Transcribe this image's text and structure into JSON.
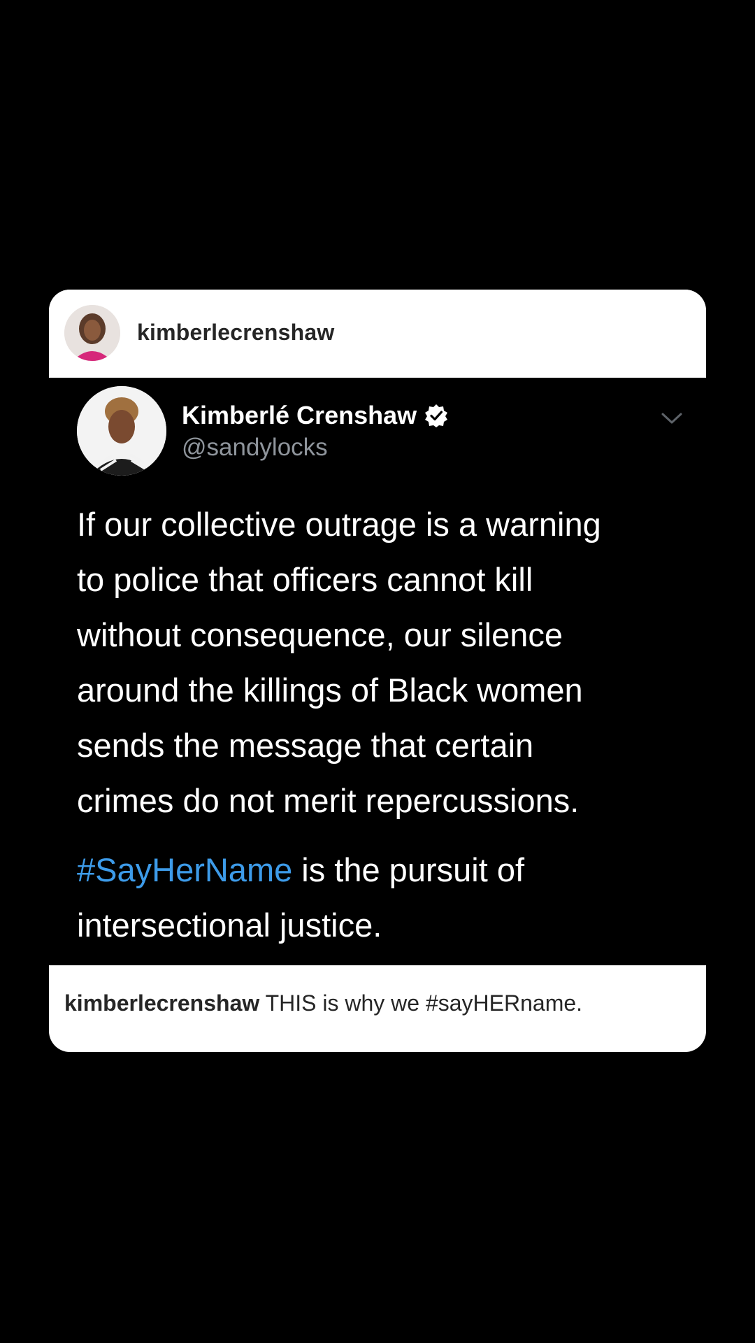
{
  "post": {
    "username": "kimberlecrenshaw",
    "tweet": {
      "display_name": "Kimberlé Crenshaw",
      "handle": "@sandylocks",
      "lines": [
        "If our collective outrage is a warning",
        "to police that officers cannot kill",
        "without consequence, our silence",
        "around the killings of Black women",
        "sends the message that certain",
        "crimes do not merit repercussions."
      ],
      "hashtag": "#SayHerName",
      "tail_line_1": " is the pursuit of",
      "tail_line_2": "intersectional justice."
    },
    "caption": {
      "username": "kimberlecrenshaw",
      "text": " THIS is why we #sayHERname."
    }
  },
  "colors": {
    "background": "#000000",
    "card": "#ffffff",
    "tweet_bg": "#000000",
    "hashtag": "#3d9be9",
    "handle": "#8f959c",
    "username_text": "#262626"
  },
  "icons": {
    "verified": "verified-badge-icon",
    "chevron": "chevron-down-icon"
  }
}
